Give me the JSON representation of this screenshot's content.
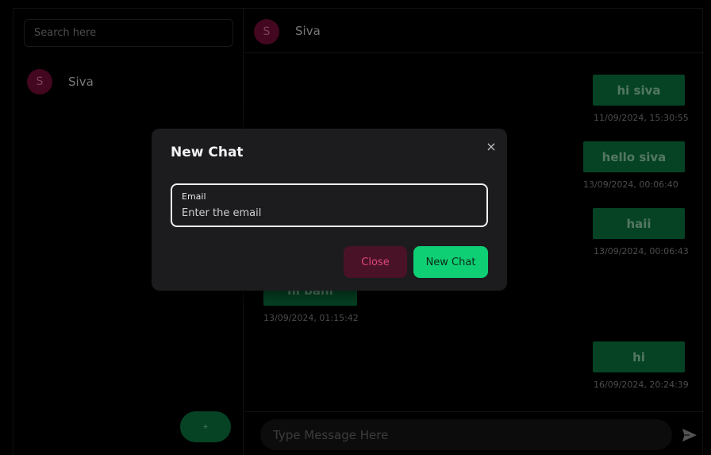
{
  "sidebar": {
    "search_placeholder": "Search here",
    "contacts": [
      {
        "initial": "S",
        "name": "Siva"
      }
    ],
    "fab_label": "+"
  },
  "chat": {
    "header": {
      "initial": "S",
      "name": "Siva"
    },
    "messages": [
      {
        "text": "hi siva",
        "time": "11/09/2024, 15:30:55",
        "side": "right"
      },
      {
        "text": "hello siva",
        "time": "13/09/2024, 00:06:40",
        "side": "right"
      },
      {
        "text": "haii",
        "time": "13/09/2024, 00:06:43",
        "side": "right"
      },
      {
        "text": "hi bahi",
        "time": "13/09/2024, 01:15:42",
        "side": "left"
      },
      {
        "text": "hi",
        "time": "16/09/2024, 20:24:39",
        "side": "right"
      }
    ],
    "composer_placeholder": "Type Message Here",
    "send_icon": "send-icon"
  },
  "modal": {
    "title": "New Chat",
    "close_icon": "×",
    "field_label": "Email",
    "field_placeholder": "Enter the email",
    "cancel_label": "Close",
    "submit_label": "New Chat"
  },
  "colors": {
    "accent_green": "#0ecf74",
    "bubble_green": "#0a7a42",
    "avatar_pink": "#7a0d3a",
    "cancel_pink": "#e0457f"
  }
}
